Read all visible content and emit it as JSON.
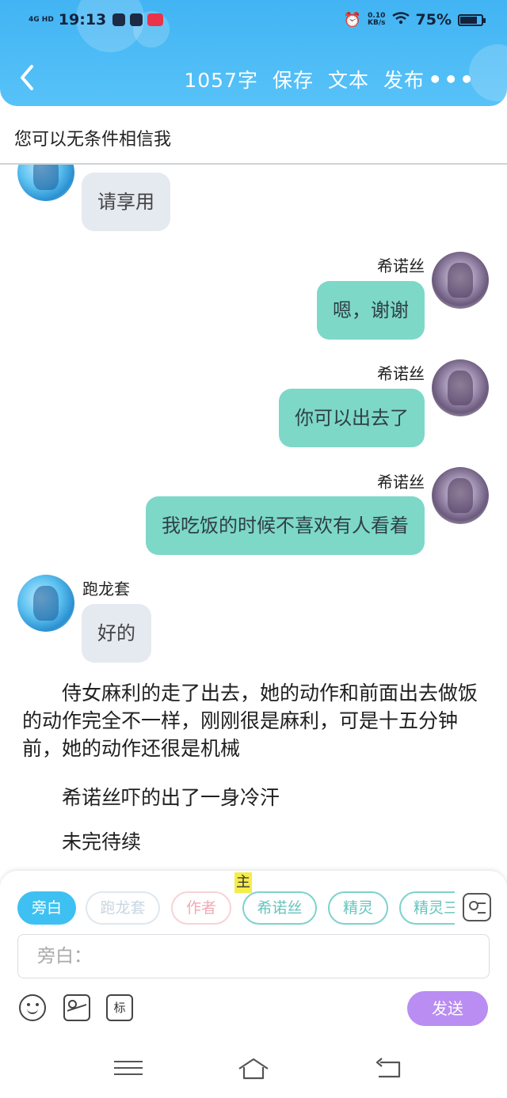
{
  "status_bar": {
    "network": "4G HD",
    "time": "19:13",
    "speed_value": "0.10",
    "speed_unit": "KB/s",
    "battery_percent": "75%",
    "battery_level": 0.75
  },
  "toolbar": {
    "word_count": "1057字",
    "save_label": "保存",
    "text_label": "文本",
    "publish_label": "发布",
    "more_label": "•••"
  },
  "story_title": "您可以无条件相信我",
  "messages": [
    {
      "sender": "",
      "text": "请享用",
      "side": "left"
    },
    {
      "sender": "希诺丝",
      "text": "嗯，谢谢",
      "side": "right"
    },
    {
      "sender": "希诺丝",
      "text": "你可以出去了",
      "side": "right"
    },
    {
      "sender": "希诺丝",
      "text": "我吃饭的时候不喜欢有人看着",
      "side": "right"
    },
    {
      "sender": "跑龙套",
      "text": "好的",
      "side": "left"
    }
  ],
  "narration": [
    "侍女麻利的走了出去，她的动作和前面出去做饭的动作完全不一样，刚刚很是麻利，可是十五分钟前，她的动作还很是机械",
    "希诺丝吓的出了一身冷汗",
    "未完待续"
  ],
  "role_chips": [
    "旁白",
    "跑龙套",
    "作者",
    "希诺丝",
    "精灵",
    "精灵三"
  ],
  "role_marker": "主",
  "input": {
    "placeholder": "旁白："
  },
  "tools": {
    "tag_label": "标"
  },
  "send_label": "发送",
  "colors": {
    "header": "#42b4f3",
    "self_bubble": "#7dd8c8",
    "other_bubble": "#e5e9f0",
    "send_button": "#b98df2",
    "active_chip": "#3ec1f2"
  }
}
